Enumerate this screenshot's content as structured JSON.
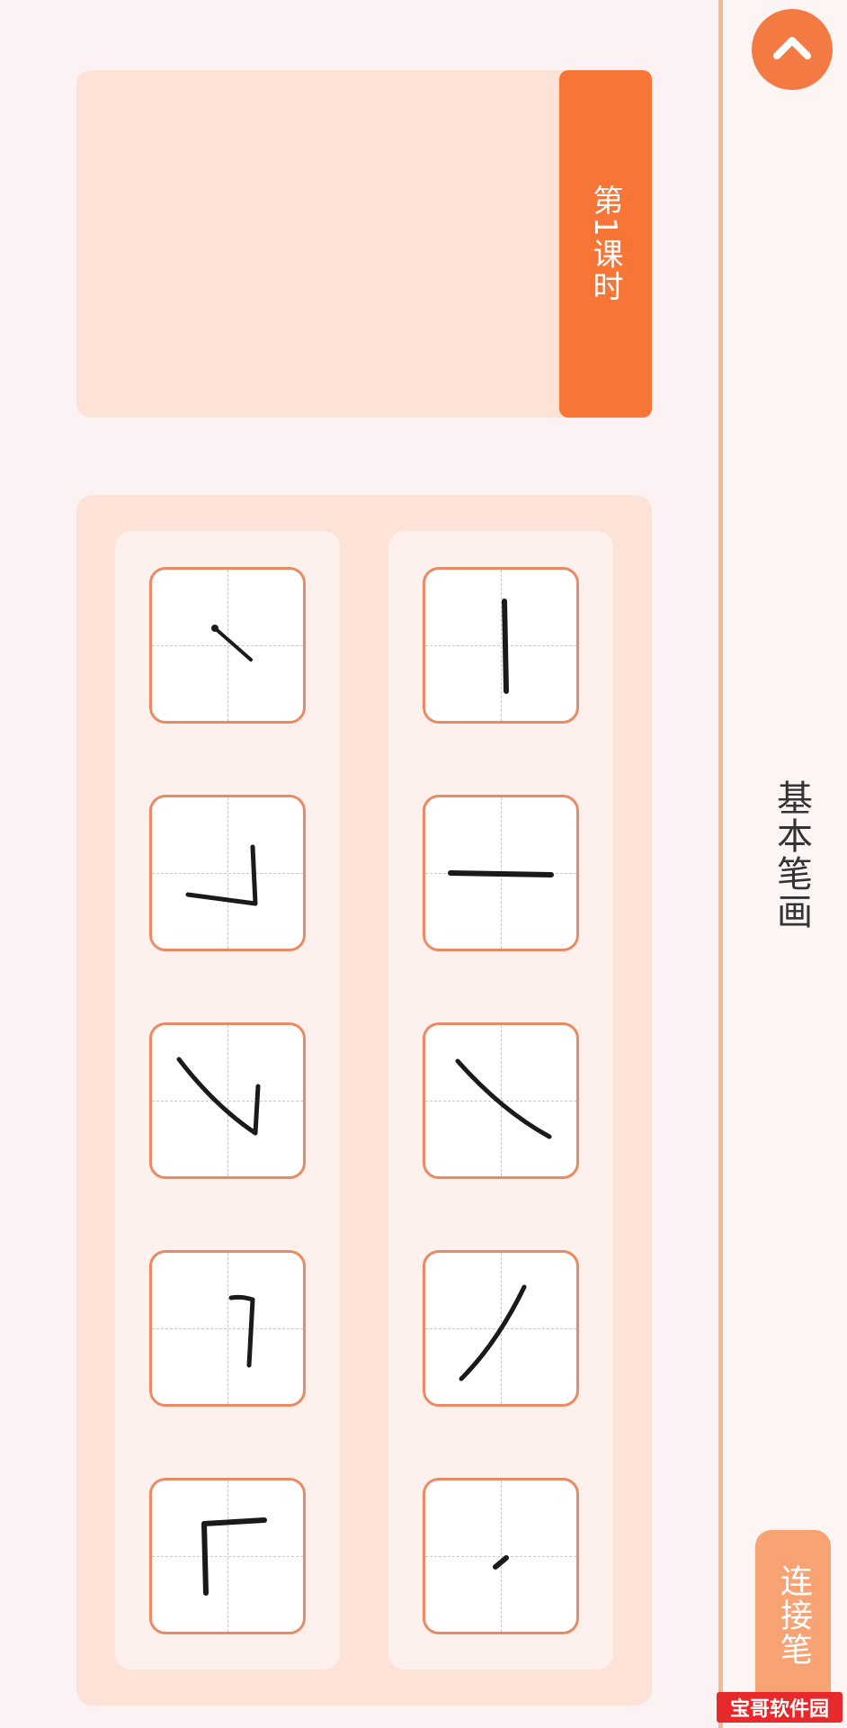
{
  "lesson": {
    "tab_label": "第1课时"
  },
  "section": {
    "title": "基本笔画"
  },
  "buttons": {
    "connect_label": "连接笔"
  },
  "icons": {
    "collapse": "chevron-up-icon"
  },
  "strokes_grid": {
    "column_a": [
      "piedian",
      "hengzhe",
      "hengpie",
      "hengzhegou",
      "shuzhe"
    ],
    "column_b": [
      "heng",
      "shu",
      "pie",
      "na",
      "dian"
    ]
  },
  "colors": {
    "accent": "#f77637",
    "accent_light": "#f7a374",
    "panel": "#fce2d7",
    "tile_border": "#e98a62",
    "background": "#fcf1f3"
  },
  "watermark": {
    "text": "宝哥软件园"
  }
}
